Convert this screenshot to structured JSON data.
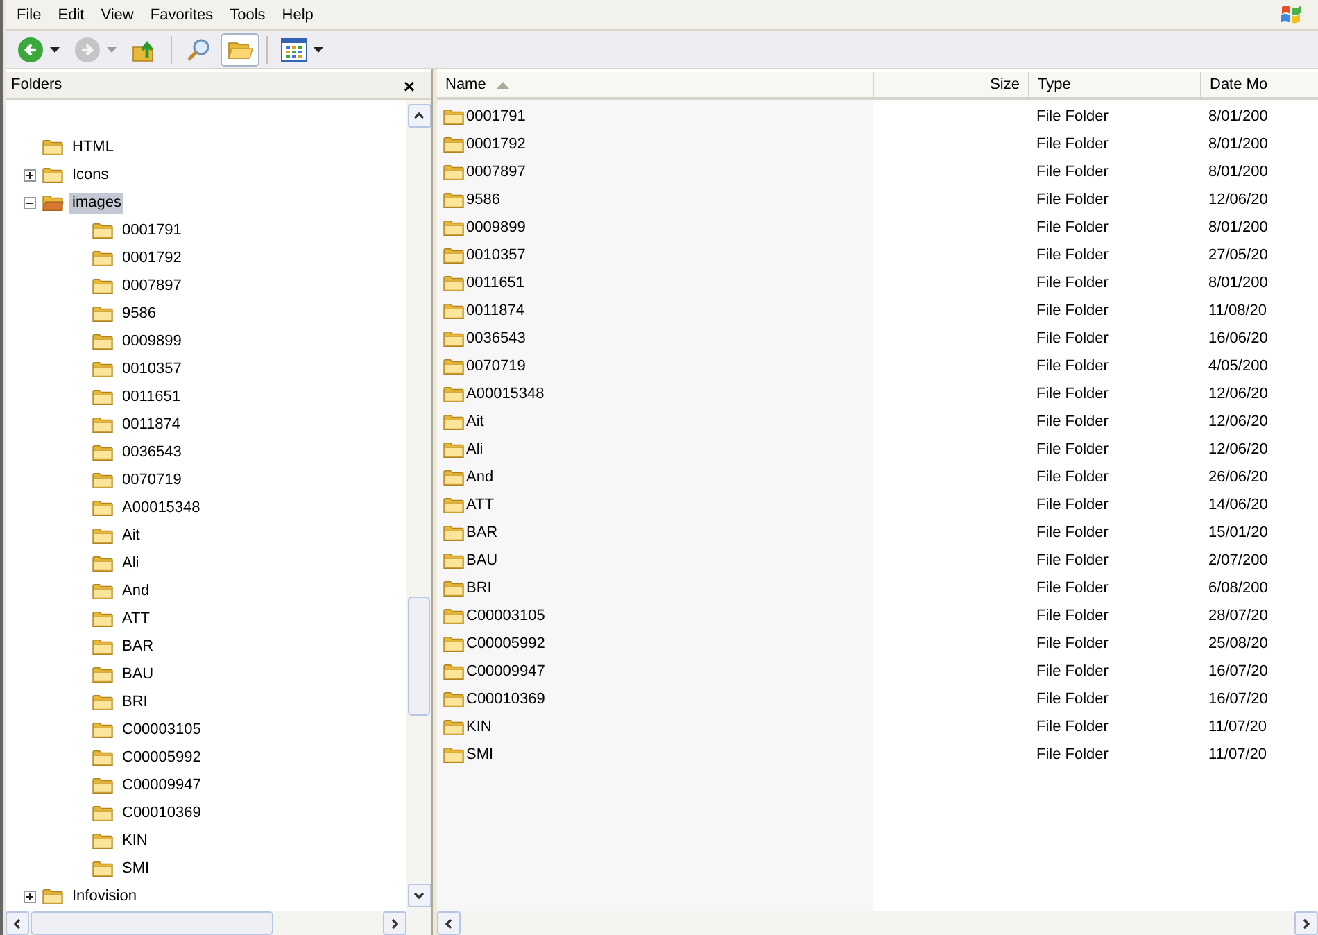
{
  "menu": [
    "File",
    "Edit",
    "View",
    "Favorites",
    "Tools",
    "Help"
  ],
  "toolbar": [
    {
      "kind": "back",
      "disabled": false,
      "dropdown": true,
      "selected": false
    },
    {
      "kind": "forward",
      "disabled": true,
      "dropdown": true,
      "selected": false
    },
    {
      "kind": "up",
      "disabled": false,
      "dropdown": false,
      "selected": false
    },
    {
      "kind": "search",
      "disabled": false,
      "dropdown": false,
      "selected": false
    },
    {
      "kind": "folders",
      "disabled": false,
      "dropdown": false,
      "selected": true
    },
    {
      "kind": "views",
      "disabled": false,
      "dropdown": true,
      "selected": false
    }
  ],
  "folders_pane": {
    "title": "Folders",
    "close": "×",
    "tree": [
      {
        "label": "HTML",
        "expandable": false,
        "expanded": false,
        "selected": false
      },
      {
        "label": "Icons",
        "expandable": true,
        "expanded": false,
        "selected": false
      },
      {
        "label": "images",
        "expandable": true,
        "expanded": true,
        "selected": true,
        "children": [
          {
            "label": "0001791"
          },
          {
            "label": "0001792"
          },
          {
            "label": "0007897"
          },
          {
            "label": "9586"
          },
          {
            "label": "0009899"
          },
          {
            "label": "0010357"
          },
          {
            "label": "0011651"
          },
          {
            "label": "0011874"
          },
          {
            "label": "0036543"
          },
          {
            "label": "0070719"
          },
          {
            "label": "A00015348"
          },
          {
            "label": "Ait"
          },
          {
            "label": "Ali"
          },
          {
            "label": "And"
          },
          {
            "label": "ATT"
          },
          {
            "label": "BAR"
          },
          {
            "label": "BAU"
          },
          {
            "label": "BRI"
          },
          {
            "label": "C00003105"
          },
          {
            "label": "C00005992"
          },
          {
            "label": "C00009947"
          },
          {
            "label": "C00010369"
          },
          {
            "label": "KIN"
          },
          {
            "label": "SMI"
          }
        ]
      },
      {
        "label": "Infovision",
        "expandable": true,
        "expanded": false,
        "selected": false
      }
    ]
  },
  "file_list": {
    "columns": [
      {
        "label": "Name",
        "sorted": true
      },
      {
        "label": "Size",
        "sorted": false
      },
      {
        "label": "Type",
        "sorted": false
      },
      {
        "label": "Date Mo",
        "sorted": false
      }
    ],
    "rows": [
      [
        "0001791",
        "",
        "File Folder",
        "8/01/200"
      ],
      [
        "0001792",
        "",
        "File Folder",
        "8/01/200"
      ],
      [
        "0007897",
        "",
        "File Folder",
        "8/01/200"
      ],
      [
        "9586",
        "",
        "File Folder",
        "12/06/20"
      ],
      [
        "0009899",
        "",
        "File Folder",
        "8/01/200"
      ],
      [
        "0010357",
        "",
        "File Folder",
        "27/05/20"
      ],
      [
        "0011651",
        "",
        "File Folder",
        "8/01/200"
      ],
      [
        "0011874",
        "",
        "File Folder",
        "11/08/20"
      ],
      [
        "0036543",
        "",
        "File Folder",
        "16/06/20"
      ],
      [
        "0070719",
        "",
        "File Folder",
        "4/05/200"
      ],
      [
        "A00015348",
        "",
        "File Folder",
        "12/06/20"
      ],
      [
        "Ait",
        "",
        "File Folder",
        "12/06/20"
      ],
      [
        "Ali",
        "",
        "File Folder",
        "12/06/20"
      ],
      [
        "And",
        "",
        "File Folder",
        "26/06/20"
      ],
      [
        "ATT",
        "",
        "File Folder",
        "14/06/20"
      ],
      [
        "BAR",
        "",
        "File Folder",
        "15/01/20"
      ],
      [
        "BAU",
        "",
        "File Folder",
        "2/07/200"
      ],
      [
        "BRI",
        "",
        "File Folder",
        "6/08/200"
      ],
      [
        "C00003105",
        "",
        "File Folder",
        "28/07/20"
      ],
      [
        "C00005992",
        "",
        "File Folder",
        "25/08/20"
      ],
      [
        "C00009947",
        "",
        "File Folder",
        "16/07/20"
      ],
      [
        "C00010369",
        "",
        "File Folder",
        "16/07/20"
      ],
      [
        "KIN",
        "",
        "File Folder",
        "11/07/20"
      ],
      [
        "SMI",
        "",
        "File Folder",
        "11/07/20"
      ]
    ]
  }
}
